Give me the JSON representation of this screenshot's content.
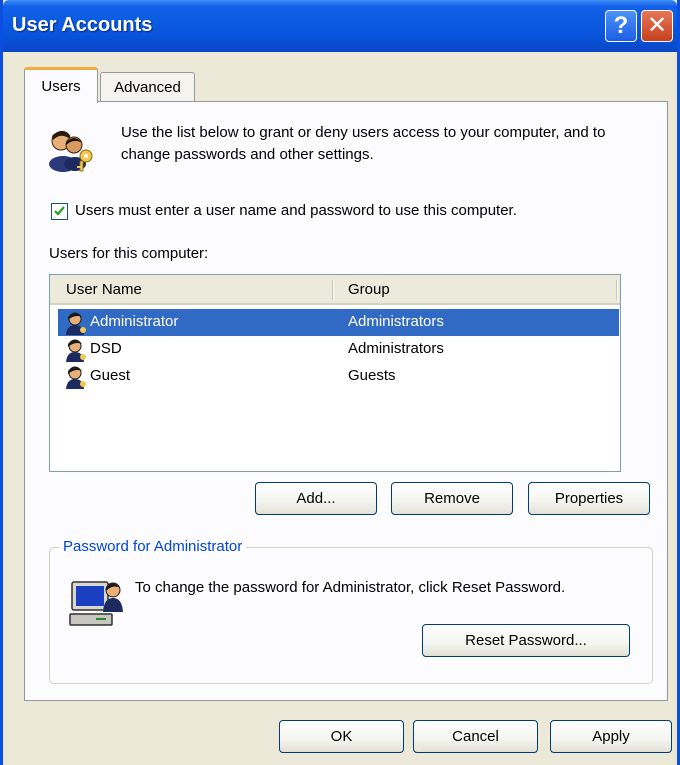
{
  "window": {
    "title": "User Accounts",
    "help_glyph": "?",
    "close_glyph": "✕"
  },
  "tabs": [
    {
      "label": "Users",
      "active": true
    },
    {
      "label": "Advanced",
      "active": false
    }
  ],
  "intro": {
    "text": "Use the list below to grant or deny users access to your computer, and to change passwords and other settings.",
    "icon": "users-key-icon"
  },
  "require_login": {
    "checked": true,
    "label": "Users must enter a user name and password to use this computer."
  },
  "users_list": {
    "label": "Users for this computer:",
    "columns": [
      "User Name",
      "Group"
    ],
    "rows": [
      {
        "name": "Administrator",
        "group": "Administrators",
        "selected": true
      },
      {
        "name": "DSD",
        "group": "Administrators",
        "selected": false
      },
      {
        "name": "Guest",
        "group": "Guests",
        "selected": false
      }
    ]
  },
  "list_buttons": {
    "add": "Add...",
    "remove": "Remove",
    "properties": "Properties"
  },
  "password": {
    "legend": "Password for Administrator",
    "text": "To change the password for Administrator, click Reset Password.",
    "reset_label": "Reset Password...",
    "icon": "computer-user-icon"
  },
  "footer": {
    "ok": "OK",
    "cancel": "Cancel",
    "apply": "Apply"
  },
  "colors": {
    "titlebar": "#0a5ae2",
    "selection": "#316ac5",
    "legend": "#0046d5",
    "tab_accent": "#f5a93a"
  }
}
